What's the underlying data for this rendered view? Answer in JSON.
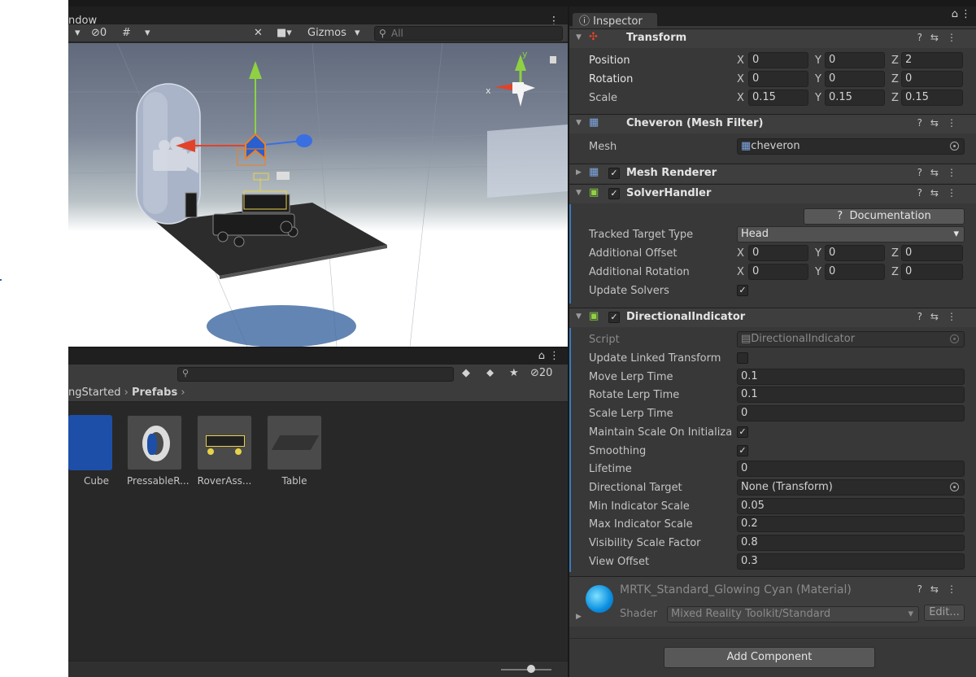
{
  "scene": {
    "title": "ndow",
    "hidden_count": "0",
    "gizmos_label": "Gizmos",
    "search_placeholder": "All",
    "gizmo_axis_y": "y",
    "gizmo_axis_x": "x"
  },
  "project": {
    "hidden_count": "20",
    "breadcrumb": [
      "ngStarted",
      "Prefabs"
    ],
    "assets": [
      "Cube",
      "PressableR...",
      "RoverAss...",
      "Table"
    ]
  },
  "inspector": {
    "tab_label": "Inspector",
    "transform": {
      "title": "Transform",
      "rows": [
        {
          "label": "Position",
          "x": "0",
          "y": "0",
          "z": "2"
        },
        {
          "label": "Rotation",
          "x": "0",
          "y": "0",
          "z": "0"
        },
        {
          "label": "Scale",
          "x": "0.15",
          "y": "0.15",
          "z": "0.15"
        }
      ]
    },
    "mesh_filter": {
      "title": "Cheveron (Mesh Filter)",
      "mesh_label": "Mesh",
      "mesh_value": "cheveron"
    },
    "mesh_renderer": {
      "title": "Mesh Renderer"
    },
    "solver_handler": {
      "title": "SolverHandler",
      "documentation_label": "Documentation",
      "tracked_target_label": "Tracked Target Type",
      "tracked_target_value": "Head",
      "additional_offset_label": "Additional Offset",
      "additional_offset": {
        "x": "0",
        "y": "0",
        "z": "0"
      },
      "additional_rotation_label": "Additional Rotation",
      "additional_rotation": {
        "x": "0",
        "y": "0",
        "z": "0"
      },
      "update_solvers_label": "Update Solvers"
    },
    "directional_indicator": {
      "title": "DirectionalIndicator",
      "script_label": "Script",
      "script_value": "DirectionalIndicator",
      "fields": [
        {
          "label": "Update Linked Transform",
          "type": "checkbox",
          "checked": false
        },
        {
          "label": "Move Lerp Time",
          "type": "text",
          "value": "0.1"
        },
        {
          "label": "Rotate Lerp Time",
          "type": "text",
          "value": "0.1"
        },
        {
          "label": "Scale Lerp Time",
          "type": "text",
          "value": "0"
        },
        {
          "label": "Maintain Scale On Initializa",
          "type": "checkbox",
          "checked": true
        },
        {
          "label": "Smoothing",
          "type": "checkbox",
          "checked": true
        },
        {
          "label": "Lifetime",
          "type": "text",
          "value": "0"
        },
        {
          "label": "Directional Target",
          "type": "object",
          "value": "None (Transform)"
        },
        {
          "label": "Min Indicator Scale",
          "type": "text",
          "value": "0.05"
        },
        {
          "label": "Max Indicator Scale",
          "type": "text",
          "value": "0.2"
        },
        {
          "label": "Visibility Scale Factor",
          "type": "text",
          "value": "0.8"
        },
        {
          "label": "View Offset",
          "type": "text",
          "value": "0.3"
        }
      ]
    },
    "material": {
      "title": "MRTK_Standard_Glowing Cyan (Material)",
      "shader_label": "Shader",
      "shader_value": "Mixed Reality Toolkit/Standard",
      "edit_label": "Edit..."
    },
    "add_component_label": "Add Component",
    "checkmark": "✓"
  },
  "colors": {
    "accent_blue": "#3a79bb",
    "x_axis": "#e2422a",
    "y_axis": "#8fd142",
    "z_axis": "#3a6fe2"
  }
}
